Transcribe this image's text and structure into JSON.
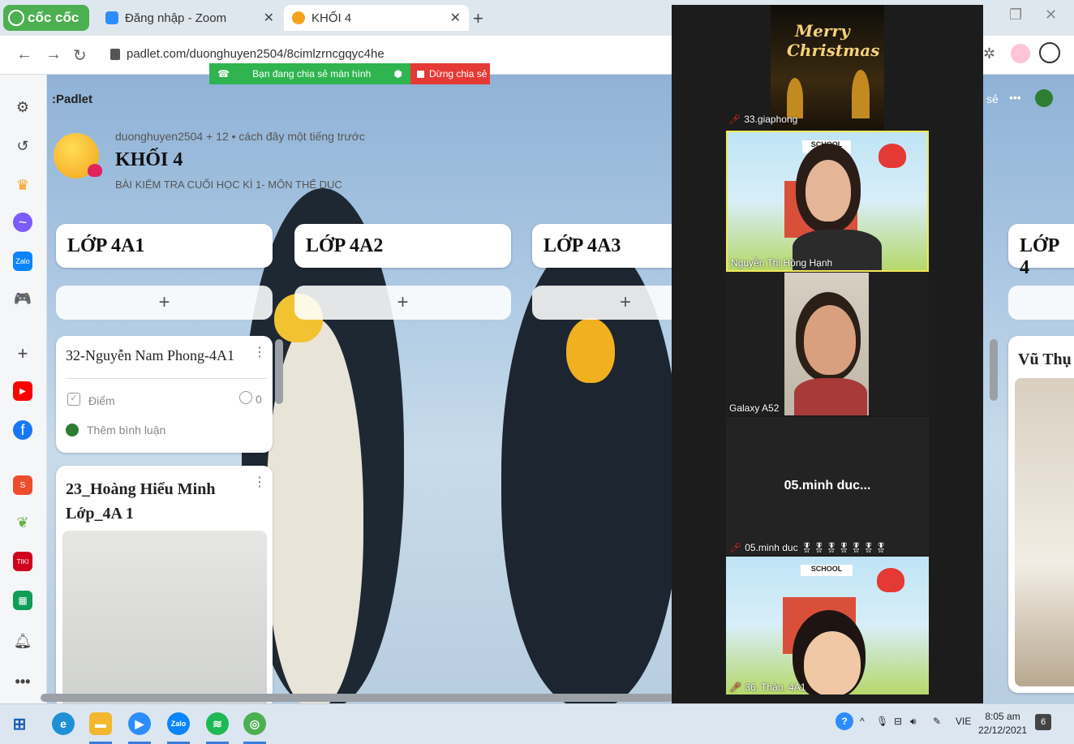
{
  "browser": {
    "brand": "cốc cốc",
    "tabs": [
      {
        "label": "Đăng nhập - Zoom"
      },
      {
        "label": "KHỐI 4"
      }
    ],
    "url": "padlet.com/duonghuyen2504/8cimlzrncgqyc4he"
  },
  "share_bar": {
    "sharing_text": "Bạn đang chia sẻ màn hình",
    "stop_label": "Dừng chia sẻ"
  },
  "padlet": {
    "brand": ":Padlet",
    "meta": "duonghuyen2504 + 12 • cách đây một tiếng trước",
    "title": "KHỐI 4",
    "subtitle": "BÀI KIỂM TRA CUỐI HỌC KÌ 1- MÔN THỂ DỤC",
    "top_right_partial": "sẻ",
    "columns": [
      {
        "title": "LỚP 4A1"
      },
      {
        "title": "LỚP 4A2"
      },
      {
        "title": "LỚP 4A3"
      },
      {
        "title": "LỚP 4"
      }
    ],
    "add_label": "+",
    "card1": {
      "title": "32-Nguyễn Nam Phong-4A1",
      "grade_label": "Điểm",
      "comment_count": "0",
      "add_comment": "Thêm bình luận"
    },
    "card2": {
      "title_line1": "23_Hoàng Hiểu Minh",
      "title_line2": "Lớp_4A 1"
    },
    "right_card_title": "Vũ Thụ"
  },
  "zoom": {
    "tile1": {
      "name": "33.giaphong",
      "image_text_1": "Merry",
      "image_text_2": "Christmas"
    },
    "tile2": {
      "name": "Nguyễn Thị Hồng Hạnh",
      "banner": "SCHOOL"
    },
    "tile3": {
      "name": "Galaxy A52"
    },
    "tile4": {
      "name": "05.minh duc...",
      "label": "05.minh duc 🎖🎖🎖🎖🎖🎖🎖"
    },
    "tile5": {
      "name": "36. Thảo. 4A1",
      "banner": "SCHOOL"
    }
  },
  "taskbar": {
    "language": "VIE",
    "time": "8:05 am",
    "date": "22/12/2021",
    "notification_count": "6"
  },
  "colors": {
    "brand_green": "#4caf50",
    "share_green": "#2fb44f",
    "stop_red": "#e53935",
    "zoom_bg": "#1c1c1c"
  }
}
